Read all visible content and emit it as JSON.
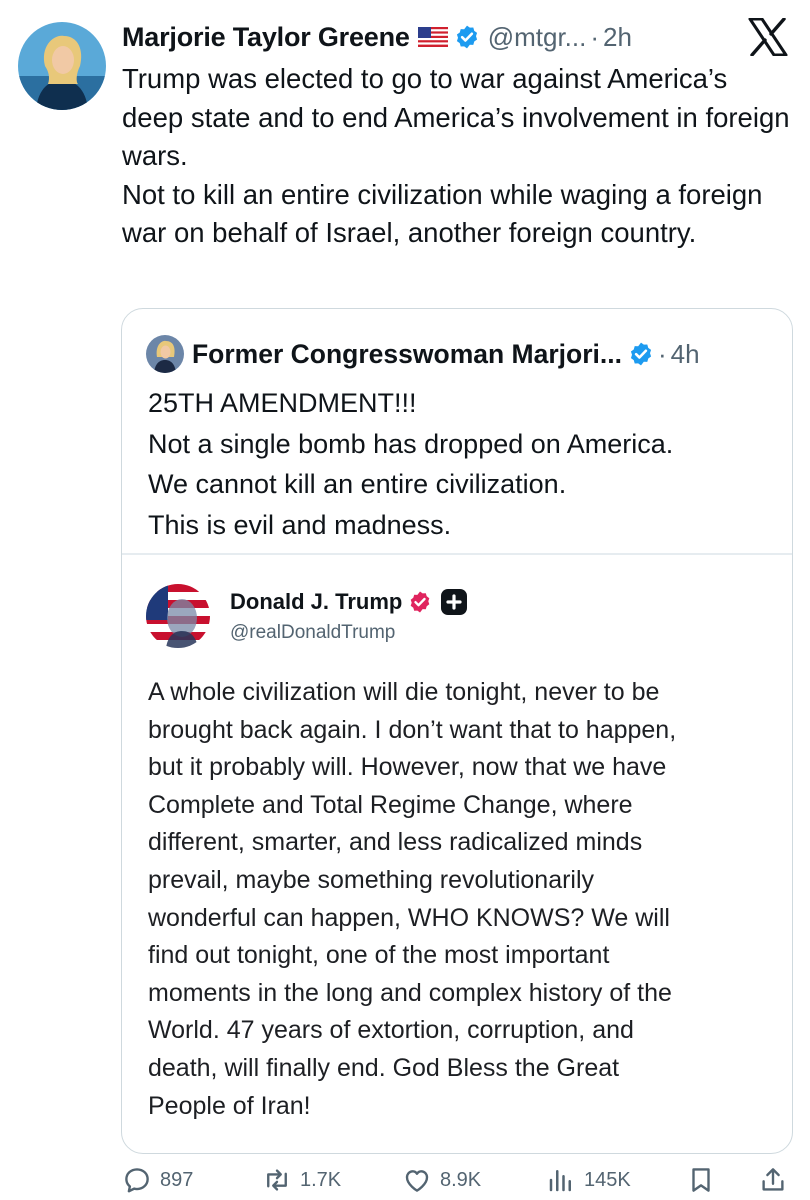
{
  "post": {
    "author_name": "Marjorie Taylor Greene",
    "author_flag": "🇺🇸",
    "author_handle": "@mtgr...",
    "separator": "·",
    "time": "2h",
    "text": "Trump was elected to go to war against America’s deep state and to end America’s involvement in foreign wars.\nNot to kill an entire civilization while waging a foreign war on behalf of Israel, another foreign country.",
    "platform_logo": "x-logo-icon"
  },
  "quote": {
    "author_name": "Former Congresswoman Marjori...",
    "separator": "·",
    "time": "4h",
    "text": "25TH AMENDMENT!!!\nNot a single bomb has dropped on America.\nWe cannot kill an entire civilization.\nThis is evil and madness."
  },
  "embedded_post": {
    "author_name": "Donald J. Trump",
    "author_handle": "@realDonaldTrump",
    "text": "A whole civilization will die tonight, never to be\nbrought back again. I don’t want that to happen,\nbut it probably will. However, now that we have\nComplete and Total Regime Change, where\ndifferent, smarter, and less radicalized minds\nprevail, maybe something revolutionarily\nwonderful can happen, WHO KNOWS? We will\nfind out tonight, one of the most important\nmoments in the long and complex history of the\nWorld. 47 years of extortion, corruption, and\ndeath, will finally end. God Bless the Great\nPeople of Iran!"
  },
  "actions": {
    "replies": "897",
    "reposts": "1.7K",
    "likes": "8.9K",
    "views": "145K",
    "icons": [
      "reply-icon",
      "repost-icon",
      "like-icon",
      "views-icon",
      "bookmark-icon",
      "share-icon"
    ]
  },
  "colors": {
    "verified_blue": "#1d9bf0",
    "truth_badge_red": "#e0245e",
    "secondary_text": "#536471",
    "border": "#cfd9de"
  }
}
